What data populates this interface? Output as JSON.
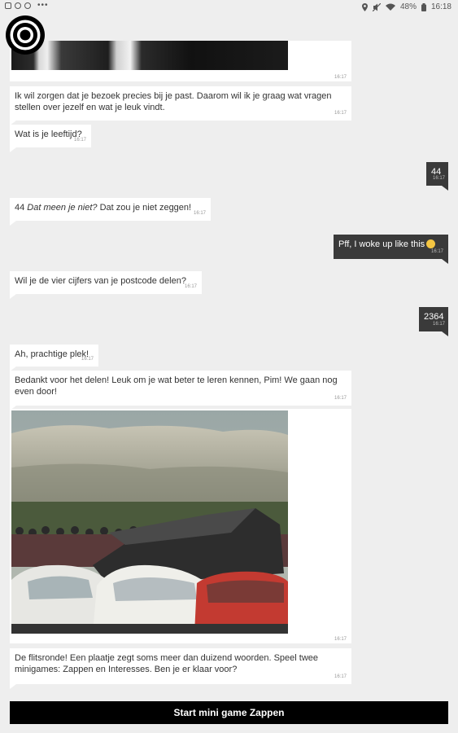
{
  "status_bar": {
    "battery": "48%",
    "time": "16:18",
    "dots": "•••"
  },
  "messages": [
    {
      "id": "m1",
      "text": "Ik wil zorgen dat je bezoek precies bij je past. Daarom wil ik je graag wat vragen stellen over jezelf en wat je leuk vindt.",
      "time": "16:17"
    },
    {
      "id": "m2",
      "text": "Wat is je leeftijd?",
      "time": "16:17"
    },
    {
      "id": "m3",
      "text": "44",
      "time": "16:17"
    },
    {
      "id": "m4",
      "text_plain": "44 ",
      "text_italic": "Dat meen je niet?",
      "text_rest": " Dat zou je niet zeggen!",
      "time": "16:17"
    },
    {
      "id": "m5",
      "text": "Pff, I woke up like this",
      "time": "16:17"
    },
    {
      "id": "m6",
      "text": "Wil je de vier cijfers van je postcode delen?",
      "time": "16:17"
    },
    {
      "id": "m7",
      "text": "2364",
      "time": "16:17"
    },
    {
      "id": "m8",
      "text": "Ah, prachtige plek!",
      "time": "16:17"
    },
    {
      "id": "m9",
      "text": "Bedankt voor het delen! Leuk om je wat beter te leren kennen, Pim! We gaan nog even door!",
      "time": "16:17"
    },
    {
      "id": "m10",
      "time": "16:17"
    },
    {
      "id": "m11",
      "text": "De flitsronde! Een plaatje zegt soms meer dan duizend woorden. Speel twee minigames: Zappen en Interesses. Ben je er klaar voor?",
      "time": "16:17"
    }
  ],
  "top_image_time": "16:17",
  "start_button_label": "Start mini game Zappen",
  "colors": {
    "outgoing_bubble": "#3a3a3a",
    "incoming_bubble": "#ffffff",
    "background": "#eeeeee",
    "button": "#000000"
  }
}
